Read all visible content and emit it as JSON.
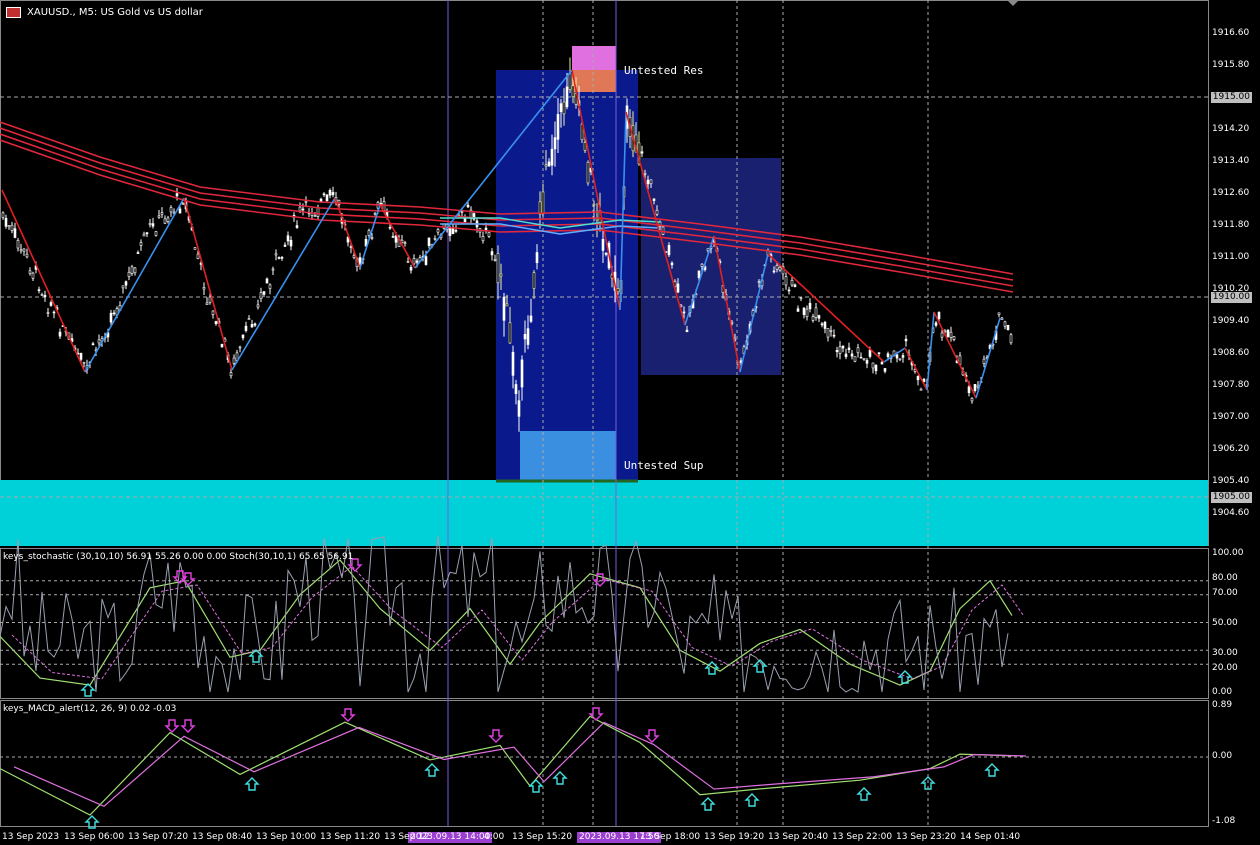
{
  "window": {
    "title": "XAUUSD., M5: US Gold vs US dollar"
  },
  "zones": {
    "resistance_label": "Untested Res",
    "support_label": "Untested Sup"
  },
  "price_tags": {
    "upper": "1915.00",
    "middle": "1910.00",
    "lower": "1905.00"
  },
  "main_axis_ticks": [
    "1916.60",
    "1915.80",
    "1915.00",
    "1914.20",
    "1913.40",
    "1912.60",
    "1911.80",
    "1911.00",
    "1910.20",
    "1909.40",
    "1908.60",
    "1907.80",
    "1907.00",
    "1906.20",
    "1905.40",
    "1904.60"
  ],
  "stoch": {
    "header": "keys_stochastic (30,10,10) 56.91 55.26 0.00 0.00 Stoch(30,10,1) 65.65 56.91",
    "ticks": [
      "100.00",
      "80.00",
      "70.00",
      "50.00",
      "30.00",
      "20.00",
      "0.00"
    ]
  },
  "macd": {
    "header": "keys_MACD_alert(12, 26, 9) 0.02 -0.03",
    "ticks": [
      "0.89",
      "0.00",
      "-1.08"
    ]
  },
  "time_axis": {
    "labels": [
      "13 Sep 2023",
      "13 Sep 06:00",
      "13 Sep 07:20",
      "13 Sep 08:40",
      "13 Sep 10:00",
      "13 Sep 11:20",
      "13 Sep 12",
      "13 Sep 15:20",
      "13 Sep 18:00",
      "13 Sep 19:20",
      "13 Sep 20:40",
      "13 Sep 22:00",
      "13 Sep 23:20",
      "14 Sep 01:40"
    ],
    "highlight_1": "2023.09.13 14:00",
    "highlight_1_tail": "4:00",
    "highlight_2": "2023.09.13 17:50"
  },
  "colors": {
    "background": "#000000",
    "ma": "#e0283c",
    "band": "#00d0d8",
    "zone_dark": "#0a1a8c",
    "zone_mid": "#1a2070",
    "res": "#e070e0",
    "sup": "#3a8fe0",
    "bull": "#f0f0a0",
    "bear": "#ffffff"
  }
}
